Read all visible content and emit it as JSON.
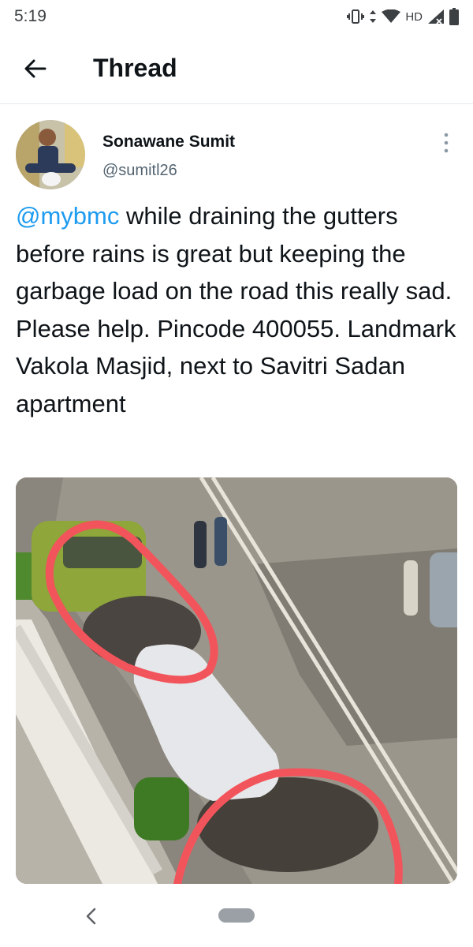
{
  "status_bar": {
    "time": "5:19",
    "network": "HD"
  },
  "header": {
    "title": "Thread"
  },
  "tweet": {
    "author_name": "Sonawane Sumit",
    "author_handle": "@sumitl26",
    "mention": "@mybmc",
    "text": " while draining the gutters before rains is great but keeping the garbage load on the road this really sad. Please help. Pincode 400055. Landmark Vakola Masjid, next to Savitri Sadan apartment"
  },
  "colors": {
    "link": "#1d9bf0",
    "text": "#0f1419",
    "secondary": "#536471",
    "circle_annotation": "#f2545b"
  },
  "icons": [
    "back-arrow-icon",
    "more-vertical-icon",
    "vibrate-icon",
    "data-arrows-icon",
    "wifi-icon",
    "cell-signal-icon",
    "battery-icon",
    "nav-back-icon"
  ]
}
